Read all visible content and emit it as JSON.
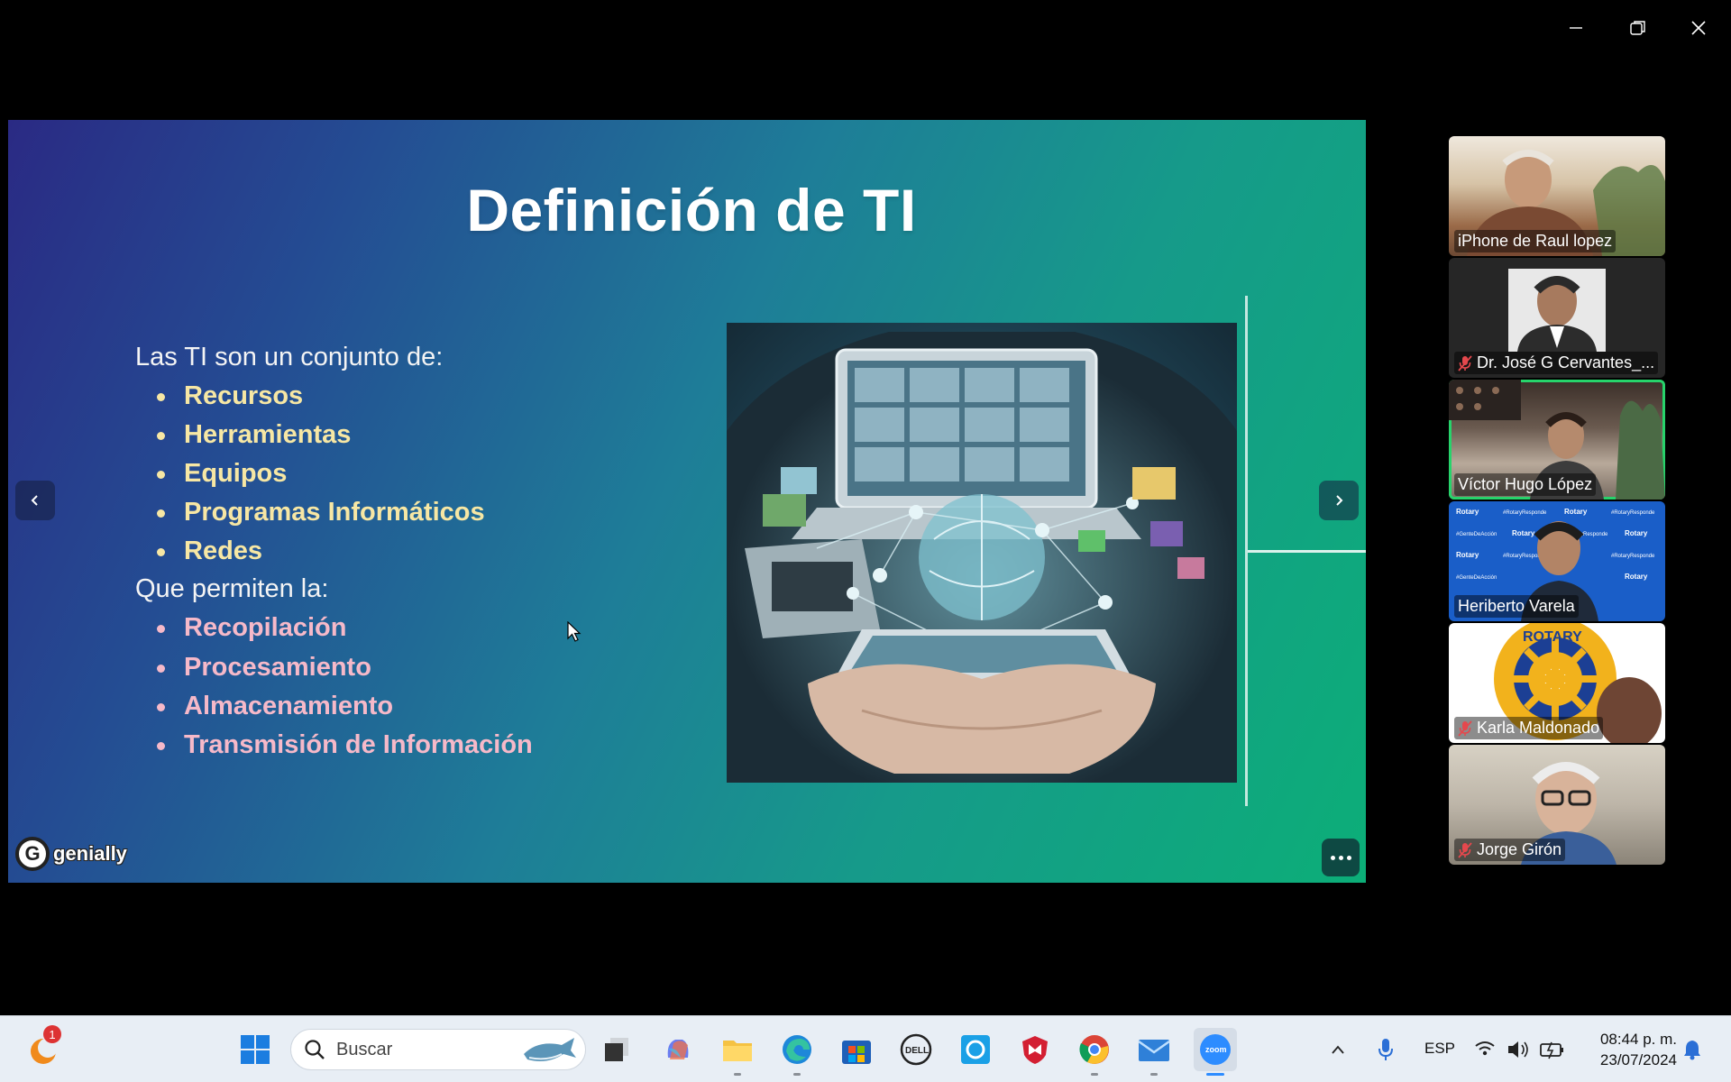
{
  "window": {
    "controls": [
      "minimize",
      "restore",
      "close"
    ]
  },
  "slide": {
    "title": "Definición de TI",
    "intro": "Las TI son un conjunto de:",
    "items_a": [
      "Recursos",
      "Herramientas",
      "Equipos",
      "Programas Informáticos",
      "Redes"
    ],
    "intro2": "Que permiten la:",
    "items_b": [
      "Recopilación",
      "Procesamiento",
      "Almacenamiento",
      "Transmisión de Información"
    ],
    "brand": "genially",
    "brand_mark": "G"
  },
  "participants": [
    {
      "name": "iPhone de Raul lopez",
      "muted": false,
      "active": false
    },
    {
      "name": "Dr. José G Cervantes_...",
      "muted": true,
      "active": false
    },
    {
      "name": "Víctor Hugo López",
      "muted": false,
      "active": true
    },
    {
      "name": "Heriberto Varela",
      "muted": false,
      "active": false
    },
    {
      "name": "Karla Maldonado",
      "muted": true,
      "active": false
    },
    {
      "name": "Jorge Girón",
      "muted": true,
      "active": false
    }
  ],
  "taskbar": {
    "search_placeholder": "Buscar",
    "badge_count": "1",
    "language": "ESP",
    "time": "08:44 p. m.",
    "date": "23/07/2024",
    "zoom_label": "zoom"
  },
  "colors": {
    "active_speaker": "#27d36b",
    "bullet_yellow": "#f7e7a4",
    "bullet_pink": "#f6b9c9"
  }
}
